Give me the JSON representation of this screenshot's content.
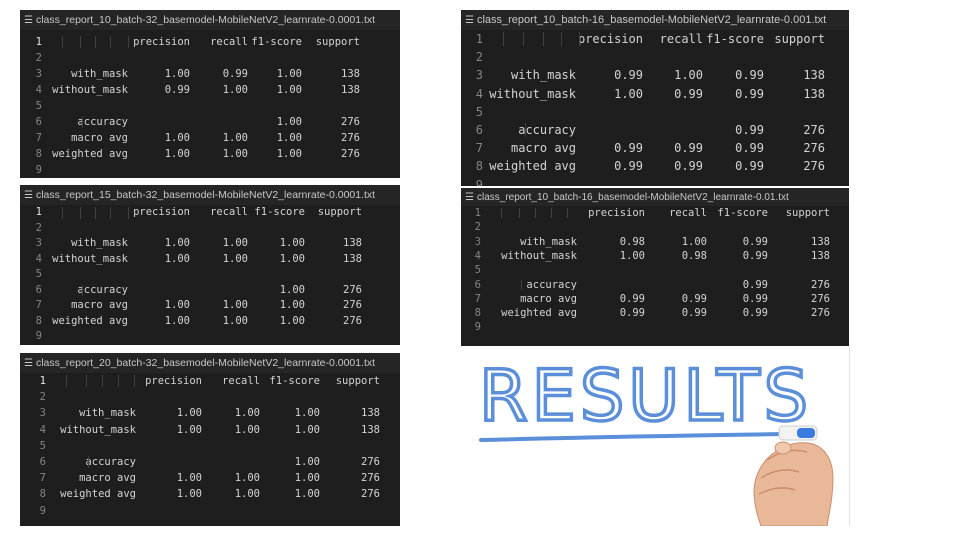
{
  "panels": [
    {
      "filename": "class_report_10_batch-32_basemodel-MobileNetV2_learnrate-0.0001.txt",
      "header": [
        "precision",
        "recall",
        "f1-score",
        "support"
      ],
      "rows": [
        {
          "line": "3",
          "label": "with_mask",
          "values": [
            "1.00",
            "0.99",
            "1.00",
            "138"
          ]
        },
        {
          "line": "4",
          "label": "without_mask",
          "values": [
            "0.99",
            "1.00",
            "1.00",
            "138"
          ]
        },
        {
          "line": "6",
          "label": "accuracy",
          "values": [
            "",
            "",
            "1.00",
            "276"
          ]
        },
        {
          "line": "7",
          "label": "macro avg",
          "values": [
            "1.00",
            "1.00",
            "1.00",
            "276"
          ]
        },
        {
          "line": "8",
          "label": "weighted avg",
          "values": [
            "1.00",
            "1.00",
            "1.00",
            "276"
          ]
        }
      ],
      "line_numbers": [
        "1",
        "2",
        "3",
        "4",
        "5",
        "6",
        "7",
        "8",
        "9"
      ]
    },
    {
      "filename": "class_report_15_batch-32_basemodel-MobileNetV2_learnrate-0.0001.txt",
      "header": [
        "precision",
        "recall",
        "f1-score",
        "support"
      ],
      "rows": [
        {
          "line": "3",
          "label": "with_mask",
          "values": [
            "1.00",
            "1.00",
            "1.00",
            "138"
          ]
        },
        {
          "line": "4",
          "label": "without_mask",
          "values": [
            "1.00",
            "1.00",
            "1.00",
            "138"
          ]
        },
        {
          "line": "6",
          "label": "accuracy",
          "values": [
            "",
            "",
            "1.00",
            "276"
          ]
        },
        {
          "line": "7",
          "label": "macro avg",
          "values": [
            "1.00",
            "1.00",
            "1.00",
            "276"
          ]
        },
        {
          "line": "8",
          "label": "weighted avg",
          "values": [
            "1.00",
            "1.00",
            "1.00",
            "276"
          ]
        }
      ],
      "line_numbers": [
        "1",
        "2",
        "3",
        "4",
        "5",
        "6",
        "7",
        "8",
        "9"
      ]
    },
    {
      "filename": "class_report_20_batch-32_basemodel-MobileNetV2_learnrate-0.0001.txt",
      "header": [
        "precision",
        "recall",
        "f1-score",
        "support"
      ],
      "rows": [
        {
          "line": "3",
          "label": "with_mask",
          "values": [
            "1.00",
            "1.00",
            "1.00",
            "138"
          ]
        },
        {
          "line": "4",
          "label": "without_mask",
          "values": [
            "1.00",
            "1.00",
            "1.00",
            "138"
          ]
        },
        {
          "line": "6",
          "label": "accuracy",
          "values": [
            "",
            "",
            "1.00",
            "276"
          ]
        },
        {
          "line": "7",
          "label": "macro avg",
          "values": [
            "1.00",
            "1.00",
            "1.00",
            "276"
          ]
        },
        {
          "line": "8",
          "label": "weighted avg",
          "values": [
            "1.00",
            "1.00",
            "1.00",
            "276"
          ]
        }
      ],
      "line_numbers": [
        "1",
        "2",
        "3",
        "4",
        "5",
        "6",
        "7",
        "8",
        "9"
      ]
    },
    {
      "filename": "class_report_10_batch-16_basemodel-MobileNetV2_learnrate-0.001.txt",
      "header": [
        "precision",
        "recall",
        "f1-score",
        "support"
      ],
      "rows": [
        {
          "line": "3",
          "label": "with_mask",
          "values": [
            "0.99",
            "1.00",
            "0.99",
            "138"
          ]
        },
        {
          "line": "4",
          "label": "without_mask",
          "values": [
            "1.00",
            "0.99",
            "0.99",
            "138"
          ]
        },
        {
          "line": "6",
          "label": "accuracy",
          "values": [
            "",
            "",
            "0.99",
            "276"
          ]
        },
        {
          "line": "7",
          "label": "macro avg",
          "values": [
            "0.99",
            "0.99",
            "0.99",
            "276"
          ]
        },
        {
          "line": "8",
          "label": "weighted avg",
          "values": [
            "0.99",
            "0.99",
            "0.99",
            "276"
          ]
        }
      ],
      "line_numbers": [
        "1",
        "2",
        "3",
        "4",
        "5",
        "6",
        "7",
        "8",
        "9"
      ]
    },
    {
      "filename": "class_report_10_batch-16_basemodel-MobileNetV2_learnrate-0.01.txt",
      "header": [
        "precision",
        "recall",
        "f1-score",
        "support"
      ],
      "rows": [
        {
          "line": "3",
          "label": "with_mask",
          "values": [
            "0.98",
            "1.00",
            "0.99",
            "138"
          ]
        },
        {
          "line": "4",
          "label": "without_mask",
          "values": [
            "1.00",
            "0.98",
            "0.99",
            "138"
          ]
        },
        {
          "line": "6",
          "label": "accuracy",
          "values": [
            "",
            "",
            "0.99",
            "276"
          ]
        },
        {
          "line": "7",
          "label": "macro avg",
          "values": [
            "0.99",
            "0.99",
            "0.99",
            "276"
          ]
        },
        {
          "line": "8",
          "label": "weighted avg",
          "values": [
            "0.99",
            "0.99",
            "0.99",
            "276"
          ]
        }
      ],
      "line_numbers": [
        "1",
        "2",
        "3",
        "4",
        "5",
        "6",
        "7",
        "8",
        "9"
      ]
    }
  ],
  "results_image": {
    "word": "RESULTS",
    "ink_color": "#5b8fd9",
    "marker_cap_color": "#3a7be0"
  },
  "colors": {
    "editor_bg": "#1e1e1e",
    "tab_bg": "#252526",
    "text": "#d4d4d4",
    "line_number": "#858585"
  }
}
